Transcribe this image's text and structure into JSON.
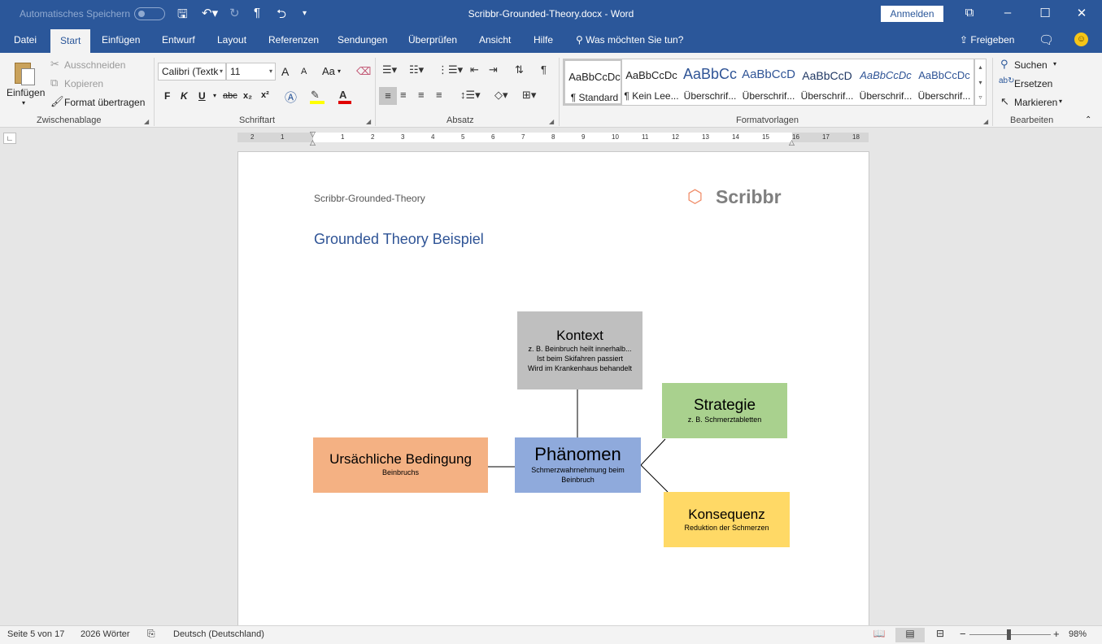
{
  "titlebar": {
    "autosave_label": "Automatisches Speichern",
    "window_title": "Scribbr-Grounded-Theory.docx  -  Word",
    "login_label": "Anmelden"
  },
  "tabs": {
    "items": [
      "Datei",
      "Start",
      "Einfügen",
      "Entwurf",
      "Layout",
      "Referenzen",
      "Sendungen",
      "Überprüfen",
      "Ansicht",
      "Hilfe"
    ],
    "active": "Start",
    "tell_me": "Was möchten Sie tun?",
    "share": "Freigeben"
  },
  "ribbon": {
    "clipboard": {
      "paste": "Einfügen",
      "cut": "Ausschneiden",
      "copy": "Kopieren",
      "format_painter": "Format übertragen",
      "label": "Zwischenablage"
    },
    "font": {
      "name": "Calibri (Textk",
      "size": "11",
      "bold": "F",
      "italic": "K",
      "underline": "U",
      "strike": "abc",
      "subscript": "x₂",
      "superscript": "x²",
      "grow": "A",
      "shrink": "A",
      "case": "Aa",
      "label": "Schriftart"
    },
    "paragraph": {
      "label": "Absatz"
    },
    "styles": {
      "items": [
        {
          "sample": "AaBbCcDc",
          "name": "¶ Standard"
        },
        {
          "sample": "AaBbCcDc",
          "name": "¶ Kein Lee..."
        },
        {
          "sample": "AaBbCc",
          "name": "Überschrif..."
        },
        {
          "sample": "AaBbCcD",
          "name": "Überschrif..."
        },
        {
          "sample": "AaBbCcD",
          "name": "Überschrif..."
        },
        {
          "sample": "AaBbCcDc",
          "name": "Überschrif..."
        },
        {
          "sample": "AaBbCcDc",
          "name": "Überschrif..."
        }
      ],
      "label": "Formatvorlagen"
    },
    "editing": {
      "find": "Suchen",
      "replace": "Ersetzen",
      "select": "Markieren",
      "label": "Bearbeiten"
    }
  },
  "ruler": {
    "numbers": [
      "2",
      "1",
      "1",
      "2",
      "3",
      "4",
      "5",
      "6",
      "7",
      "8",
      "9",
      "10",
      "11",
      "12",
      "13",
      "14",
      "15",
      "16",
      "17",
      "18"
    ]
  },
  "document": {
    "header": "Scribbr-Grounded-Theory",
    "logo_text": "Scribbr",
    "title": "Grounded Theory Beispiel",
    "diagram": {
      "kontext": {
        "title": "Kontext",
        "lines": [
          "z. B. Beinbruch heilt innerhalb...",
          "Ist beim Skifahren passiert",
          "Wird im Krankenhaus behandelt"
        ]
      },
      "strategie": {
        "title": "Strategie",
        "lines": [
          "z. B. Schmerztabletten"
        ]
      },
      "ursache": {
        "title": "Ursächliche Bedingung",
        "lines": [
          "Beinbruchs"
        ]
      },
      "phaenomen": {
        "title": "Phänomen",
        "lines": [
          "Schmerzwahrnehmung beim",
          "Beinbruch"
        ]
      },
      "konsequenz": {
        "title": "Konsequenz",
        "lines": [
          "Reduktion der Schmerzen"
        ]
      }
    }
  },
  "statusbar": {
    "page": "Seite 5 von 17",
    "words": "2026 Wörter",
    "language": "Deutsch (Deutschland)",
    "zoom_minus": "−",
    "zoom_plus": "+",
    "zoom": "98%"
  },
  "colors": {
    "word_blue": "#2b579a",
    "kontext": "#bfbfbf",
    "strategie": "#a9d18e",
    "ursache": "#f4b183",
    "phaenomen": "#8faadc",
    "konsequenz": "#ffd966",
    "title_blue": "#2f5496"
  }
}
